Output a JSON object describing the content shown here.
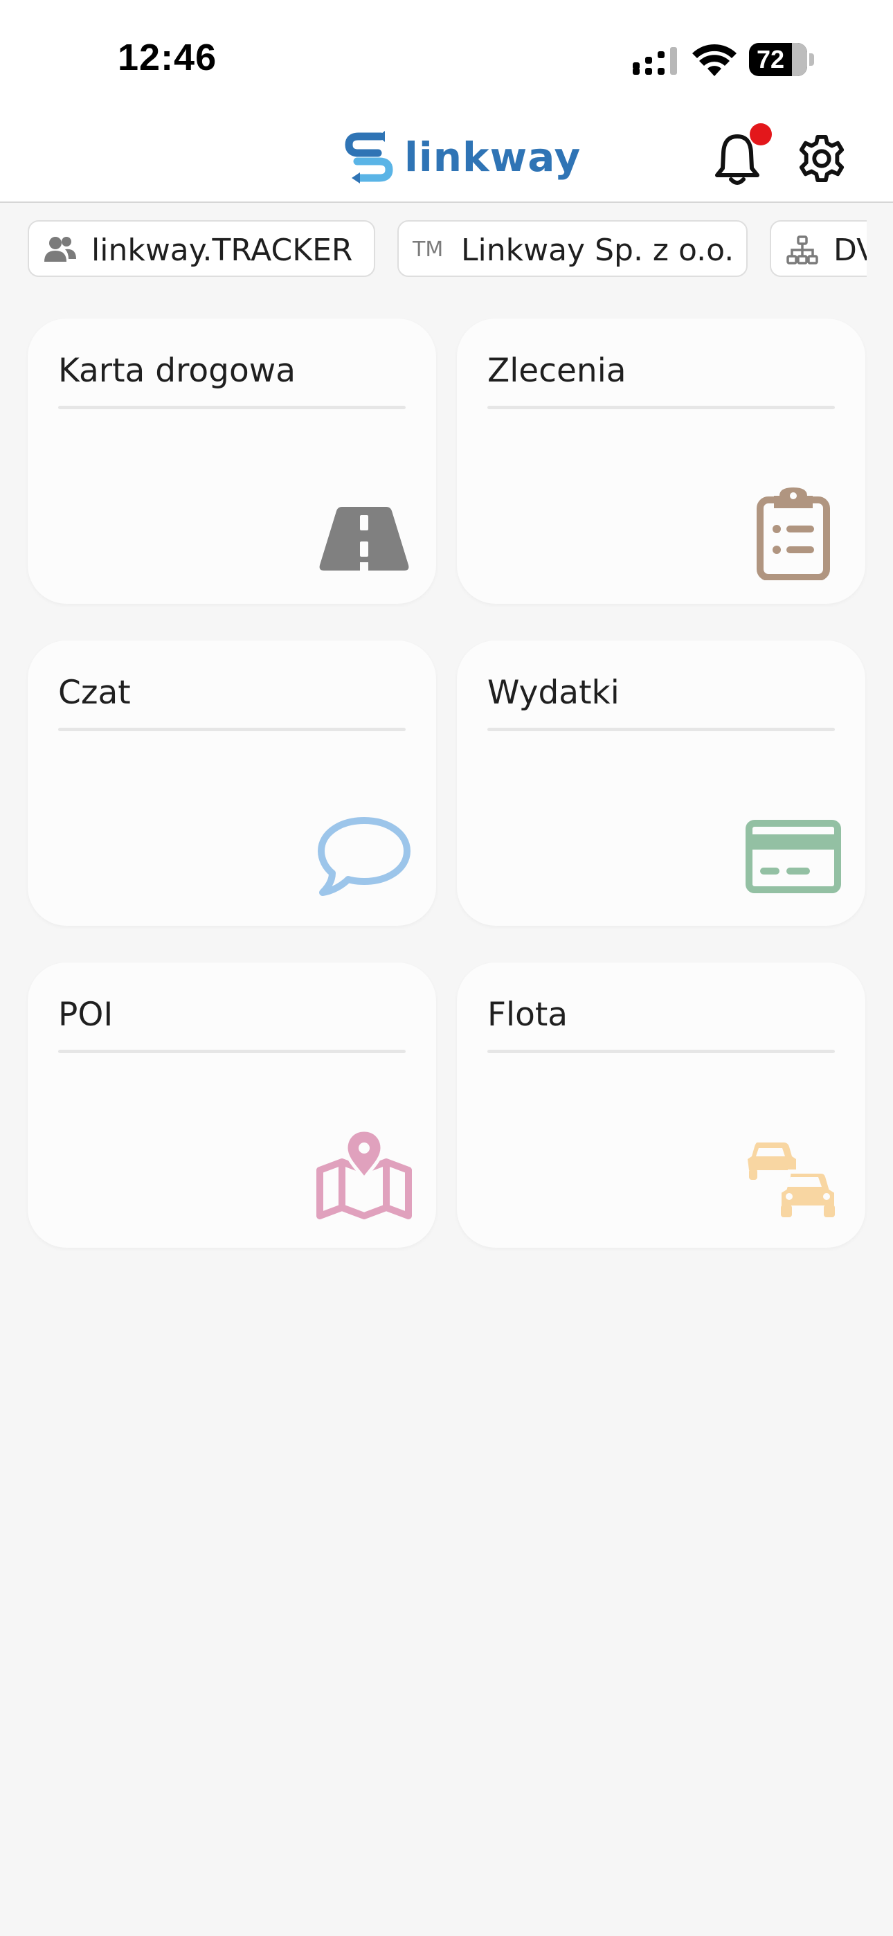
{
  "status_bar": {
    "time": "12:46",
    "battery_level": "72",
    "icons": [
      "signal-icon",
      "wifi-icon",
      "battery-icon"
    ]
  },
  "header": {
    "logo_text": "linkway",
    "has_notification": true,
    "icons": [
      "bell-icon",
      "gear-icon"
    ],
    "brand_color": "#2f74b5",
    "logo_accent_color": "#5ab4e6",
    "notification_color": "#e3171b"
  },
  "chips": [
    {
      "icon": "users-icon",
      "label": "linkway.TRACKER"
    },
    {
      "icon": "trademark-icon",
      "prefix": "TM",
      "label": "Linkway Sp. z o.o."
    },
    {
      "icon": "org-chart-icon",
      "label": "DV"
    }
  ],
  "tiles": [
    {
      "title": "Karta drogowa",
      "icon": "road-icon",
      "color": "#808080"
    },
    {
      "title": "Zlecenia",
      "icon": "clipboard-list-icon",
      "color": "#b09580"
    },
    {
      "title": "Czat",
      "icon": "chat-bubble-icon",
      "color": "#9cc5ea"
    },
    {
      "title": "Wydatki",
      "icon": "credit-card-icon",
      "color": "#93c0a3"
    },
    {
      "title": "POI",
      "icon": "map-pin-icon",
      "color": "#e0a1bd"
    },
    {
      "title": "Flota",
      "icon": "cars-icon",
      "color": "#f8d6a2"
    }
  ]
}
